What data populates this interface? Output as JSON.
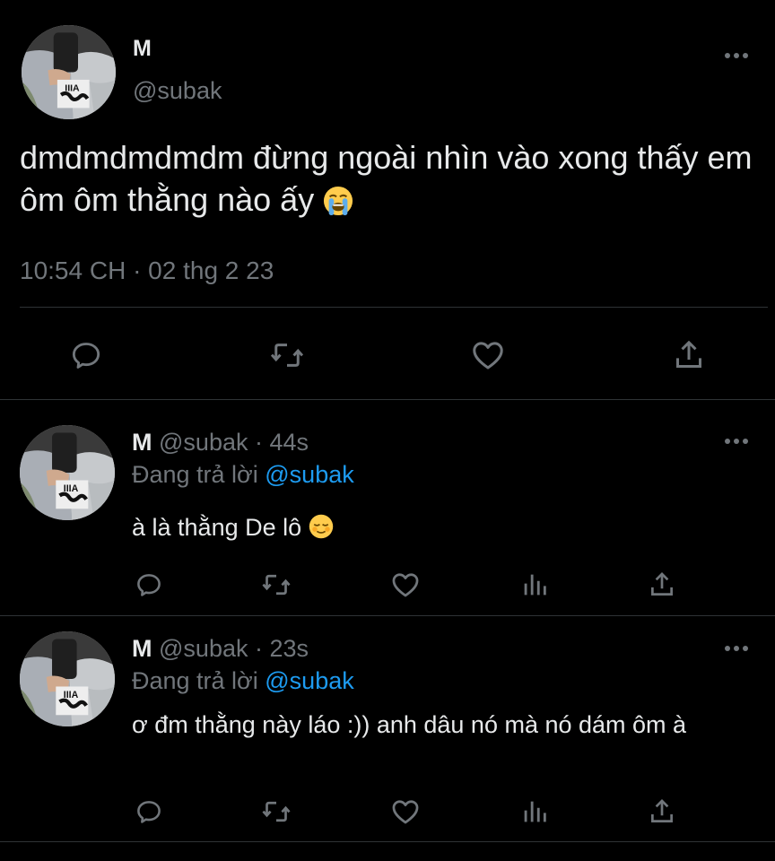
{
  "main": {
    "name": "M",
    "handle": "@subak",
    "text": "dmdmdmdmdm đừng ngoài nhìn vào xong thấy em ôm ôm thằng nào ấy",
    "emoji": "loudly-crying-face",
    "timestamp": "10:54 CH · 02 thg 2 23",
    "actions": [
      "reply-icon",
      "retweet-icon",
      "like-icon",
      "share-icon"
    ]
  },
  "replies": [
    {
      "name": "M",
      "handle": "@subak · 44s",
      "replying_prefix": "Đang trả lời ",
      "replying_to": "@subak",
      "text": "à là thằng De lô",
      "emoji": "relieved-face"
    },
    {
      "name": "M",
      "handle": "@subak · 23s",
      "replying_prefix": "Đang trả lời ",
      "replying_to": "@subak",
      "text": "ơ đm thằng này láo :)) anh dâu nó mà nó dám ôm à",
      "emoji": ""
    }
  ],
  "reply_actions": [
    "reply-icon",
    "retweet-icon",
    "like-icon",
    "analytics-icon",
    "share-icon"
  ],
  "colors": {
    "background": "#000000",
    "text": "#e7e9ea",
    "secondary": "#71767b",
    "accent": "#1d9bf0",
    "divider": "#2f3336"
  }
}
